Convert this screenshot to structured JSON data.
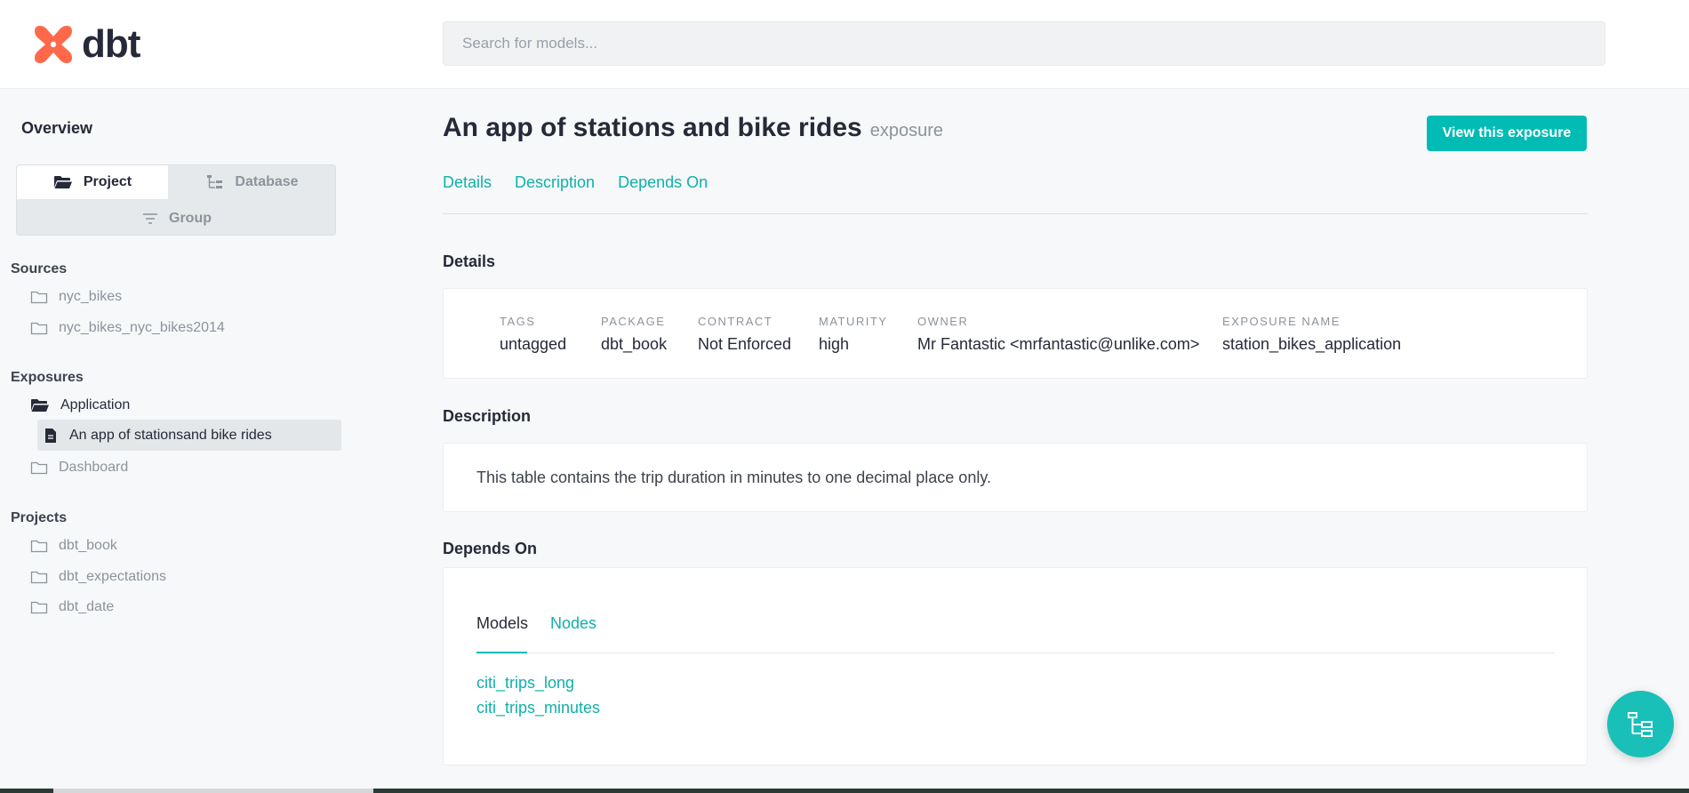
{
  "header": {
    "logo_text": "dbt",
    "search_placeholder": "Search for models..."
  },
  "sidebar": {
    "overview": "Overview",
    "switcher": {
      "project": "Project",
      "database": "Database",
      "group": "Group"
    },
    "sources": {
      "title": "Sources",
      "items": [
        "nyc_bikes",
        "nyc_bikes_nyc_bikes2014"
      ]
    },
    "exposures": {
      "title": "Exposures",
      "folders": [
        "Application",
        "Dashboard"
      ],
      "selected_item": "An app of stationsand bike rides"
    },
    "projects": {
      "title": "Projects",
      "items": [
        "dbt_book",
        "dbt_expectations",
        "dbt_date"
      ]
    }
  },
  "main": {
    "title": "An app of stations and bike rides",
    "resource_type": "exposure",
    "view_button": "View this exposure",
    "nav": [
      "Details",
      "Description",
      "Depends On"
    ],
    "details": {
      "heading": "Details",
      "fields": [
        {
          "label": "TAGS",
          "value": "untagged"
        },
        {
          "label": "PACKAGE",
          "value": "dbt_book"
        },
        {
          "label": "CONTRACT",
          "value": "Not Enforced"
        },
        {
          "label": "MATURITY",
          "value": "high"
        },
        {
          "label": "OWNER",
          "value": "Mr Fantastic <mrfantastic@unlike.com>"
        },
        {
          "label": "EXPOSURE NAME",
          "value": "station_bikes_application"
        }
      ]
    },
    "description": {
      "heading": "Description",
      "text": "This table contains the trip duration in minutes to one decimal place only."
    },
    "depends_on": {
      "heading": "Depends On",
      "tabs": [
        "Models",
        "Nodes"
      ],
      "models": [
        "citi_trips_long",
        "citi_trips_minutes"
      ]
    }
  },
  "colors": {
    "accent": "#00bcb4",
    "link": "#10b0aa",
    "logo": "#ff694a"
  }
}
